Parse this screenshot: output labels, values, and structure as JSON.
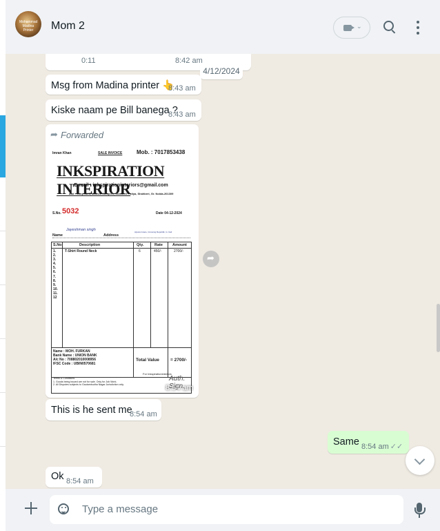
{
  "header": {
    "contact_name": "Mom 2",
    "avatar_text": "Mohammad Madina Printer"
  },
  "chat": {
    "date_chip": "4/12/2024",
    "messages": [
      {
        "text": "0:11",
        "time": "8:42 am"
      },
      {
        "text": "Msg from Madina printer 👆",
        "time": "8:43 am"
      },
      {
        "text": "Kiske naam pe Bill banega ?",
        "time": "8:43 am"
      },
      {
        "forwarded": "Forwarded",
        "time": "8:54 am"
      },
      {
        "text": "This is he sent me",
        "time": "8:54 am"
      },
      {
        "text": "Same",
        "time": "8:54 am",
        "outgoing": true
      },
      {
        "text": "Ok",
        "time": "8:54 am"
      }
    ]
  },
  "invoice": {
    "owner": "Imran Khan",
    "type": "SALE INVOICE",
    "mobile": "Mob. : 7017853438",
    "business": "INKSPIRATION INTERIOR",
    "email": "E-mail : inkspirationinteriors@gmail.com",
    "address": "Add : Shop No.5, Mohsin Complex, Shahberi Puliya, Shahberi, Gr. Noida-201309",
    "sno_label": "S.No.",
    "sno": "5032",
    "date": "Date 04-12-2024",
    "name_label": "Name",
    "address_label": "Address",
    "customer_name": "Jayeshman singh",
    "customer_address": "Ajnara Grace, Crossing Republik, G. Itail",
    "columns": [
      "S.No.",
      "Description",
      "Qty.",
      "Rate",
      "Amount"
    ],
    "rows": [
      "1.",
      "2.",
      "3.",
      "4.",
      "5.",
      "6.",
      "7.",
      "8.",
      "9.",
      "10.",
      "11.",
      "12"
    ],
    "item": {
      "description": "T-Shirt Round Neck",
      "qty": "6",
      "rate": "450/-",
      "amount": "2700/-"
    },
    "bank": "Name : MOH. FURKAN\nBank Name : UNION BANK\nA/c No : 708802010008956\nIFSC Code : UBIN0570681",
    "total_label": "Total Value",
    "total_value": "= 2700/-",
    "for_line": "For Inkspirationinteriors",
    "terms": "Terms & Conditions\n1. Goods being issued are not for sale. Only for Job Work.\n2. All Disputes subjects to Gautambudha Nagar Jurisdiction only.",
    "signature": "Auth. Sign."
  },
  "footer": {
    "placeholder": "Type a message"
  }
}
